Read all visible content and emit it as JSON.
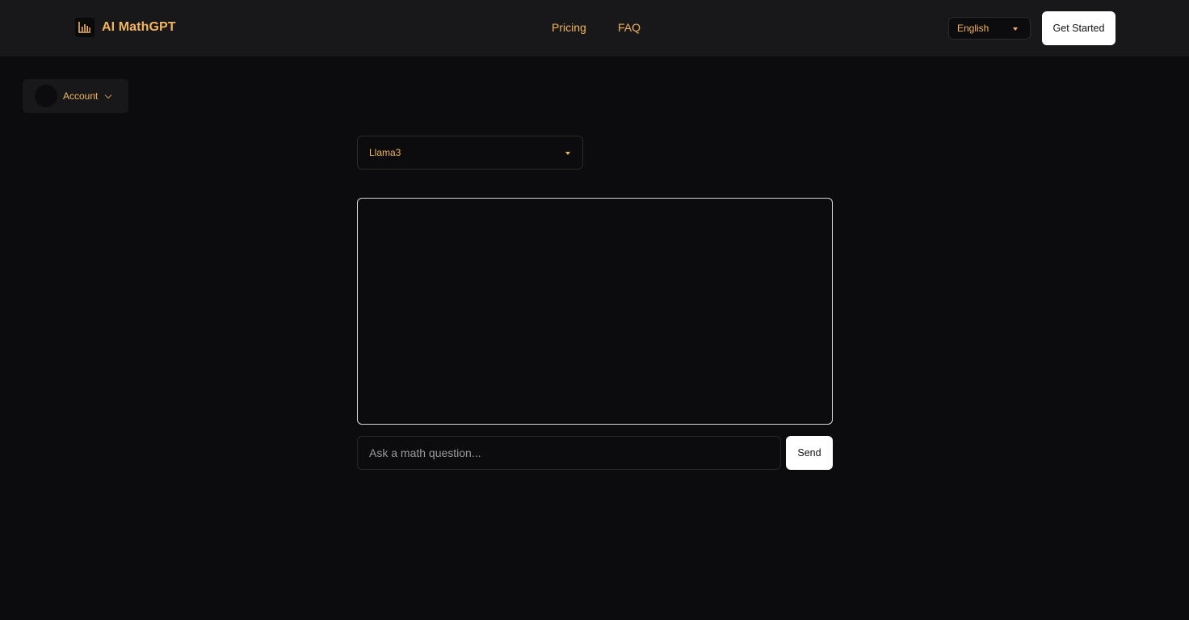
{
  "header": {
    "brand_name": "AI MathGPT",
    "brand_icon": "bar-chart-icon",
    "nav": {
      "pricing": "Pricing",
      "faq": "FAQ"
    },
    "language": {
      "selected": "English"
    },
    "get_started_label": "Get Started"
  },
  "account": {
    "label": "Account"
  },
  "model": {
    "selected": "Llama3"
  },
  "chat": {
    "input_placeholder": "Ask a math question...",
    "input_value": "",
    "send_label": "Send"
  },
  "colors": {
    "accent": "#f3b45e",
    "background": "#0c0c0e",
    "header_background": "#18181b"
  }
}
